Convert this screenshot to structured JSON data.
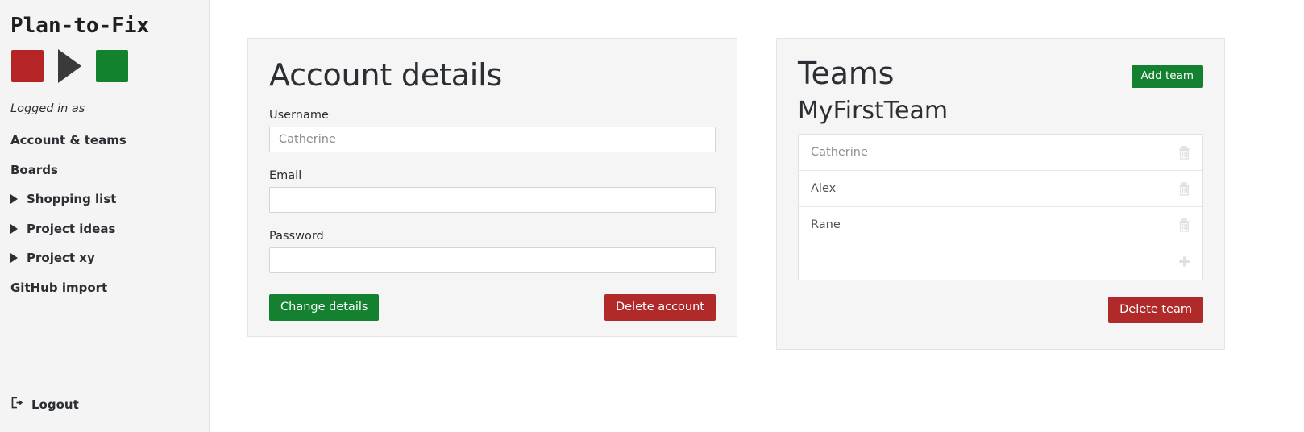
{
  "sidebar": {
    "brand": "Plan-to-Fix",
    "logo": {
      "red_icon": "red-square-icon",
      "arrow_icon": "play-triangle-icon",
      "green_icon": "green-square-icon",
      "red_color": "#b52525",
      "arrow_color": "#3a3a3a",
      "green_color": "#12822f"
    },
    "logged_in_as": "Logged in as",
    "items": [
      {
        "label": "Account & teams",
        "has_caret": false,
        "name": "account-teams"
      },
      {
        "label": "Boards",
        "has_caret": false,
        "name": "boards"
      },
      {
        "label": "Shopping list",
        "has_caret": true,
        "name": "shopping-list"
      },
      {
        "label": "Project ideas",
        "has_caret": true,
        "name": "project-ideas"
      },
      {
        "label": "Project xy",
        "has_caret": true,
        "name": "project-xy"
      },
      {
        "label": "GitHub import",
        "has_caret": false,
        "name": "github-import"
      }
    ],
    "logout": {
      "label": "Logout",
      "icon": "sign-out-icon"
    }
  },
  "account_card": {
    "title": "Account details",
    "fields": [
      {
        "label": "Username",
        "value": "",
        "placeholder": "Catherine",
        "name": "username"
      },
      {
        "label": "Email",
        "value": "",
        "placeholder": "",
        "name": "email"
      },
      {
        "label": "Password",
        "value": "",
        "placeholder": "",
        "name": "password"
      }
    ],
    "submit_label": "Change details",
    "delete_label": "Delete account",
    "submit_color": "#13812f",
    "delete_color": "#b02a2a"
  },
  "teams_card": {
    "title": "Teams",
    "add_team_label": "Add team",
    "team_name": "MyFirstTeam",
    "members": [
      {
        "name": "Catherine",
        "is_placeholder": true,
        "delete_icon": "trash-icon"
      },
      {
        "name": "Alex",
        "is_placeholder": false,
        "delete_icon": "trash-icon"
      },
      {
        "name": "Rane",
        "is_placeholder": false,
        "delete_icon": "trash-icon"
      }
    ],
    "add_member_row": {
      "label": "",
      "icon": "plus-icon"
    },
    "delete_team_label": "Delete team",
    "add_color": "#13812f",
    "delete_color": "#b02a2a"
  }
}
